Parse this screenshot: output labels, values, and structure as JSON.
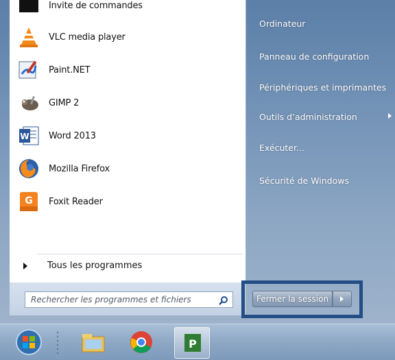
{
  "start_menu": {
    "programs": [
      {
        "label": "Invite de commandes",
        "icon": "cmd-icon"
      },
      {
        "label": "VLC media player",
        "icon": "vlc-icon"
      },
      {
        "label": "Paint.NET",
        "icon": "paintnet-icon"
      },
      {
        "label": "GIMP 2",
        "icon": "gimp-icon"
      },
      {
        "label": "Word 2013",
        "icon": "word-icon"
      },
      {
        "label": "Mozilla Firefox",
        "icon": "firefox-icon"
      },
      {
        "label": "Foxit Reader",
        "icon": "foxit-icon"
      }
    ],
    "all_programs_label": "Tous les programmes",
    "search_placeholder": "Rechercher les programmes et fichiers",
    "right_items": [
      {
        "label": "Ordinateur"
      },
      {
        "label": "Panneau de configuration"
      },
      {
        "label": "Périphériques et imprimantes"
      },
      {
        "label": "Outils d’administration"
      },
      {
        "label": "Exécuter..."
      },
      {
        "label": "Sécurité de Windows"
      }
    ],
    "shutdown_label": "Fermer la session"
  },
  "taskbar": {
    "items": [
      "start-orb-icon",
      "file-explorer-icon",
      "chrome-icon",
      "project-icon"
    ]
  },
  "colors": {
    "highlight_border": "#234e85",
    "menu_right_bg": "#7796b9"
  }
}
